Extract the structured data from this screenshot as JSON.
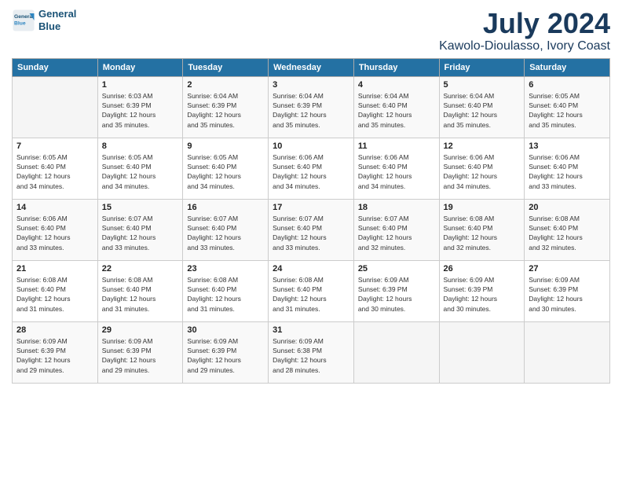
{
  "header": {
    "logo_line1": "General",
    "logo_line2": "Blue",
    "month": "July 2024",
    "location": "Kawolo-Dioulasso, Ivory Coast"
  },
  "weekdays": [
    "Sunday",
    "Monday",
    "Tuesday",
    "Wednesday",
    "Thursday",
    "Friday",
    "Saturday"
  ],
  "weeks": [
    [
      {
        "day": "",
        "info": ""
      },
      {
        "day": "1",
        "info": "Sunrise: 6:03 AM\nSunset: 6:39 PM\nDaylight: 12 hours\nand 35 minutes."
      },
      {
        "day": "2",
        "info": "Sunrise: 6:04 AM\nSunset: 6:39 PM\nDaylight: 12 hours\nand 35 minutes."
      },
      {
        "day": "3",
        "info": "Sunrise: 6:04 AM\nSunset: 6:39 PM\nDaylight: 12 hours\nand 35 minutes."
      },
      {
        "day": "4",
        "info": "Sunrise: 6:04 AM\nSunset: 6:40 PM\nDaylight: 12 hours\nand 35 minutes."
      },
      {
        "day": "5",
        "info": "Sunrise: 6:04 AM\nSunset: 6:40 PM\nDaylight: 12 hours\nand 35 minutes."
      },
      {
        "day": "6",
        "info": "Sunrise: 6:05 AM\nSunset: 6:40 PM\nDaylight: 12 hours\nand 35 minutes."
      }
    ],
    [
      {
        "day": "7",
        "info": "Sunrise: 6:05 AM\nSunset: 6:40 PM\nDaylight: 12 hours\nand 34 minutes."
      },
      {
        "day": "8",
        "info": "Sunrise: 6:05 AM\nSunset: 6:40 PM\nDaylight: 12 hours\nand 34 minutes."
      },
      {
        "day": "9",
        "info": "Sunrise: 6:05 AM\nSunset: 6:40 PM\nDaylight: 12 hours\nand 34 minutes."
      },
      {
        "day": "10",
        "info": "Sunrise: 6:06 AM\nSunset: 6:40 PM\nDaylight: 12 hours\nand 34 minutes."
      },
      {
        "day": "11",
        "info": "Sunrise: 6:06 AM\nSunset: 6:40 PM\nDaylight: 12 hours\nand 34 minutes."
      },
      {
        "day": "12",
        "info": "Sunrise: 6:06 AM\nSunset: 6:40 PM\nDaylight: 12 hours\nand 34 minutes."
      },
      {
        "day": "13",
        "info": "Sunrise: 6:06 AM\nSunset: 6:40 PM\nDaylight: 12 hours\nand 33 minutes."
      }
    ],
    [
      {
        "day": "14",
        "info": "Sunrise: 6:06 AM\nSunset: 6:40 PM\nDaylight: 12 hours\nand 33 minutes."
      },
      {
        "day": "15",
        "info": "Sunrise: 6:07 AM\nSunset: 6:40 PM\nDaylight: 12 hours\nand 33 minutes."
      },
      {
        "day": "16",
        "info": "Sunrise: 6:07 AM\nSunset: 6:40 PM\nDaylight: 12 hours\nand 33 minutes."
      },
      {
        "day": "17",
        "info": "Sunrise: 6:07 AM\nSunset: 6:40 PM\nDaylight: 12 hours\nand 33 minutes."
      },
      {
        "day": "18",
        "info": "Sunrise: 6:07 AM\nSunset: 6:40 PM\nDaylight: 12 hours\nand 32 minutes."
      },
      {
        "day": "19",
        "info": "Sunrise: 6:08 AM\nSunset: 6:40 PM\nDaylight: 12 hours\nand 32 minutes."
      },
      {
        "day": "20",
        "info": "Sunrise: 6:08 AM\nSunset: 6:40 PM\nDaylight: 12 hours\nand 32 minutes."
      }
    ],
    [
      {
        "day": "21",
        "info": "Sunrise: 6:08 AM\nSunset: 6:40 PM\nDaylight: 12 hours\nand 31 minutes."
      },
      {
        "day": "22",
        "info": "Sunrise: 6:08 AM\nSunset: 6:40 PM\nDaylight: 12 hours\nand 31 minutes."
      },
      {
        "day": "23",
        "info": "Sunrise: 6:08 AM\nSunset: 6:40 PM\nDaylight: 12 hours\nand 31 minutes."
      },
      {
        "day": "24",
        "info": "Sunrise: 6:08 AM\nSunset: 6:40 PM\nDaylight: 12 hours\nand 31 minutes."
      },
      {
        "day": "25",
        "info": "Sunrise: 6:09 AM\nSunset: 6:39 PM\nDaylight: 12 hours\nand 30 minutes."
      },
      {
        "day": "26",
        "info": "Sunrise: 6:09 AM\nSunset: 6:39 PM\nDaylight: 12 hours\nand 30 minutes."
      },
      {
        "day": "27",
        "info": "Sunrise: 6:09 AM\nSunset: 6:39 PM\nDaylight: 12 hours\nand 30 minutes."
      }
    ],
    [
      {
        "day": "28",
        "info": "Sunrise: 6:09 AM\nSunset: 6:39 PM\nDaylight: 12 hours\nand 29 minutes."
      },
      {
        "day": "29",
        "info": "Sunrise: 6:09 AM\nSunset: 6:39 PM\nDaylight: 12 hours\nand 29 minutes."
      },
      {
        "day": "30",
        "info": "Sunrise: 6:09 AM\nSunset: 6:39 PM\nDaylight: 12 hours\nand 29 minutes."
      },
      {
        "day": "31",
        "info": "Sunrise: 6:09 AM\nSunset: 6:38 PM\nDaylight: 12 hours\nand 28 minutes."
      },
      {
        "day": "",
        "info": ""
      },
      {
        "day": "",
        "info": ""
      },
      {
        "day": "",
        "info": ""
      }
    ]
  ]
}
